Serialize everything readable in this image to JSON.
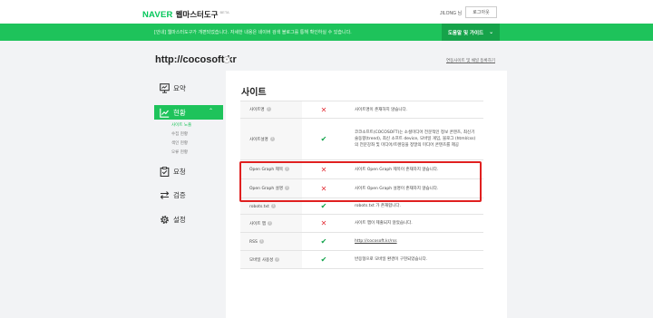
{
  "header": {
    "brand_naver": "NAVER",
    "brand_product": "웹마스터도구",
    "brand_beta": "BETA",
    "user_id": "JILONG 님",
    "logout_label": "로그아웃"
  },
  "notice": {
    "text": "[안내] 웹마스터도구가 개편되었습니다. 자세한 내용은 네이버 검색 블로그를 통해 확인하실 수 있습니다.",
    "guide_label": "도움말 및 가이드",
    "guide_chevron": "⌄"
  },
  "site": {
    "url": "http://cocosoft.kr",
    "dropdown_symbol": "▾",
    "link_label": "연동사이트 및 채널 등록하기"
  },
  "nav": {
    "summary": "요약",
    "status": "현황",
    "status_caret": "⌃",
    "sub_items": [
      "사이트 노출",
      "수집 현황",
      "색인 현황",
      "오류 현황"
    ],
    "request": "요청",
    "verify": "검증",
    "settings": "설정"
  },
  "main": {
    "title": "사이트",
    "help_symbol": "?",
    "rows": [
      {
        "label": "사이트명",
        "status": "x",
        "desc": "사이트명이 존재하지 않습니다.",
        "link": false
      },
      {
        "label": "사이트설명",
        "status": "v",
        "desc": "코코소프트(COCOSOFT)는 소셜미디어 전문적인 정보 콘텐츠, 최신기술동향(trend), 최신 소프트 device, 모바일 게임, 블로그 (html/css)의 전문강좌 및 미디어/트렌딩을 정말의 미디어 콘텐츠를 제공",
        "link": false
      },
      {
        "label": "Open Graph 제목",
        "status": "x",
        "desc": "사이트 Open Graph 제목이 존재하지 않습니다.",
        "link": false
      },
      {
        "label": "Open Graph 설명",
        "status": "x",
        "desc": "사이트 Open Graph 설명이 존재하지 않습니다.",
        "link": false
      },
      {
        "label": "robots.txt",
        "status": "v",
        "desc": "robots.txt 가 존재합니다.",
        "link": false
      },
      {
        "label": "사이트 맵",
        "status": "x",
        "desc": "사이트 맵이 제출되지 않았습니다.",
        "link": false
      },
      {
        "label": "RSS",
        "status": "v",
        "desc": "http://cocosoft.kr/rss",
        "link": true
      },
      {
        "label": "모바일 사용성",
        "status": "v",
        "desc": "반응형으로 모바일 환경이 구현되었습니다.",
        "link": false
      }
    ]
  },
  "marks": {
    "x": "✕",
    "v": "✔"
  },
  "colors": {
    "brand_green": "#1ec35b",
    "error_red": "#e3323a",
    "ok_green": "#11a34a",
    "highlight_red": "#e02020"
  }
}
